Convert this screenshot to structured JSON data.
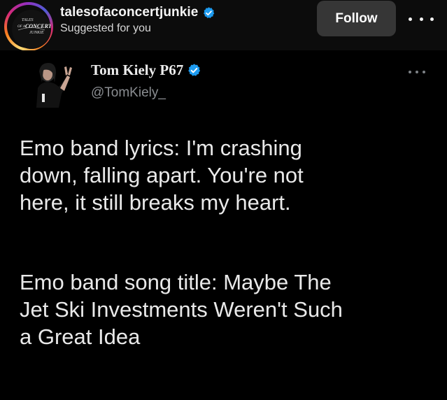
{
  "post_header": {
    "username": "talesofaconcertjunkie",
    "subtitle": "Suggested for you",
    "follow_label": "Follow",
    "avatar_logo_lines": [
      "TALES",
      "OF A",
      "CONCERT",
      "JUNKIE"
    ],
    "verified_icon": "verified-badge-icon",
    "more_icon": "more-horizontal-icon"
  },
  "tweet": {
    "display_name": "Tom Kiely P67",
    "handle": "@TomKiely_",
    "verified_icon": "verified-badge-icon",
    "more_icon": "more-horizontal-icon",
    "paragraphs": [
      {
        "lines": [
          "Emo band lyrics: I'm crashing",
          "down, falling apart. You're not",
          "here, it still breaks my heart."
        ]
      },
      {
        "lines": [
          "Emo band song title: Maybe The",
          "Jet Ski Investments Weren't Such",
          "a Great Idea"
        ]
      }
    ]
  },
  "colors": {
    "background": "#000000",
    "header_background": "#0c0c0c",
    "follow_button": "#363636",
    "verified_blue": "#1d9bf0",
    "handle_gray": "#8a8d91"
  }
}
